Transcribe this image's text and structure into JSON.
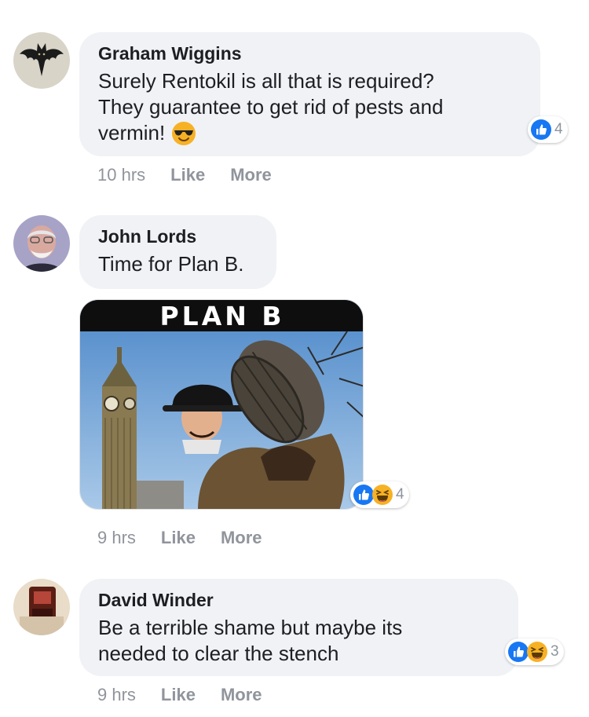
{
  "comments": [
    {
      "author": "Graham Wiggins",
      "lines": [
        "Surely Rentokil is all that is required?",
        "They guarantee to get rid of pests and",
        "vermin!"
      ],
      "emoji": "smiling-face-with-sunglasses",
      "time": "10 hrs",
      "like_label": "Like",
      "more_label": "More",
      "reaction_count": "4",
      "reactions": [
        "like"
      ]
    },
    {
      "author": "John Lords",
      "lines": [
        "Time for Plan B."
      ],
      "image_caption": "PLAN B",
      "time": "9 hrs",
      "like_label": "Like",
      "more_label": "More",
      "reaction_count": "4",
      "reactions": [
        "like",
        "haha"
      ]
    },
    {
      "author": "David Winder",
      "lines": [
        "Be a terrible shame but maybe its",
        "needed to clear the stench"
      ],
      "time": "9 hrs",
      "like_label": "Like",
      "more_label": "More",
      "reaction_count": "3",
      "reactions": [
        "like",
        "haha"
      ]
    }
  ],
  "colors": {
    "bubble": "#f0f2f5",
    "like_blue": "#1877f2",
    "haha_yellow": "#f7b125",
    "meta_gray": "#90949c"
  }
}
